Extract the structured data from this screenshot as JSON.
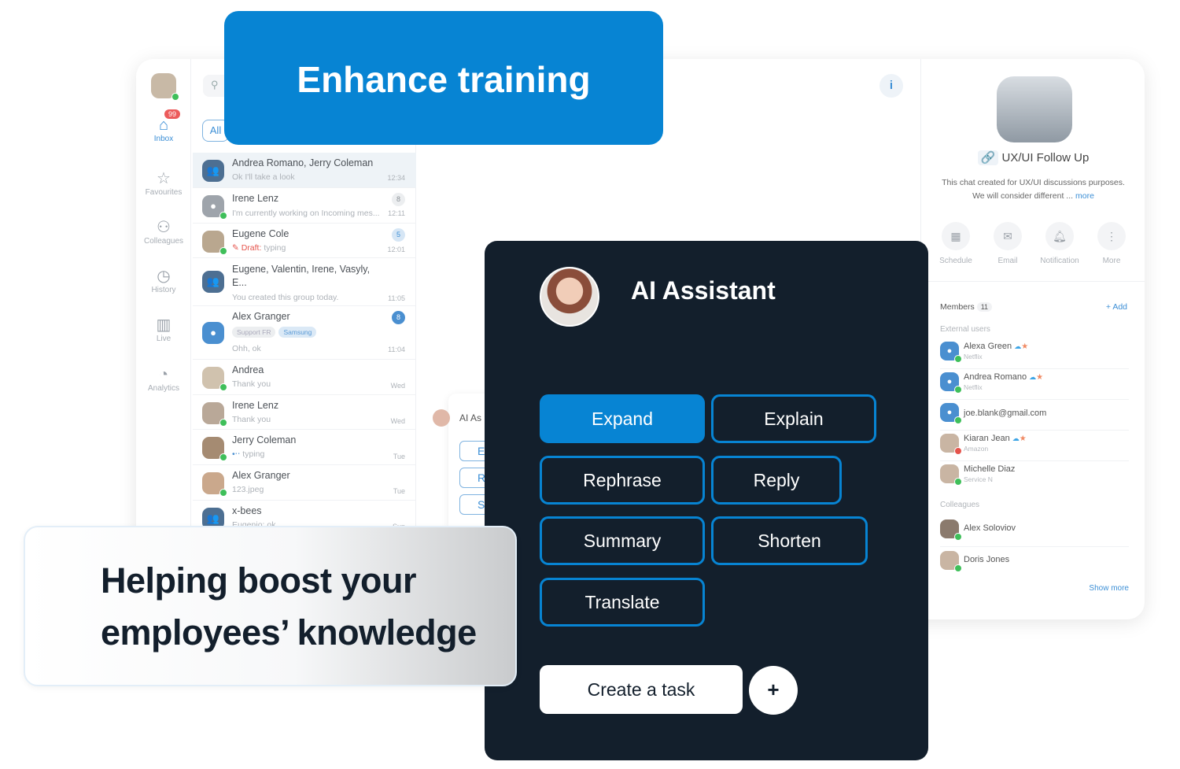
{
  "banner": {
    "title": "Enhance training"
  },
  "sidebar": {
    "inbox_badge": "99",
    "items": [
      {
        "label": "Inbox",
        "icon": "inbox-icon"
      },
      {
        "label": "Favourites",
        "icon": "star-icon"
      },
      {
        "label": "Colleagues",
        "icon": "users-icon"
      },
      {
        "label": "History",
        "icon": "clock-icon"
      },
      {
        "label": "Live",
        "icon": "bar-chart-icon"
      },
      {
        "label": "Analytics",
        "icon": "pie-chart-icon"
      }
    ]
  },
  "list": {
    "filter_all": "All",
    "chats": [
      {
        "name": "Andrea Romano, Jerry Coleman",
        "preview": "Ok I'll take a look",
        "time": "12:34"
      },
      {
        "name": "Irene Lenz",
        "preview": "I'm currently working on Incoming mes...",
        "time": "12:11",
        "count": "8"
      },
      {
        "name": "Eugene Cole",
        "draft": "Draft:",
        "preview": "typing",
        "time": "12:01",
        "count": "5"
      },
      {
        "name": "Eugene, Valentin, Irene, Vasyly, E...",
        "preview": "You created this group today.",
        "time": "11:05"
      },
      {
        "name": "Alex Granger",
        "tags": [
          "Support FR",
          "Samsung"
        ],
        "preview": "Ohh, ok",
        "time": "11:04",
        "count": "8"
      },
      {
        "name": "Andrea",
        "preview": "Thank you",
        "time": "Wed"
      },
      {
        "name": "Irene Lenz",
        "preview": "Thank you",
        "time": "Wed"
      },
      {
        "name": "Jerry Coleman",
        "preview": "typing",
        "time": "Tue"
      },
      {
        "name": "Alex Granger",
        "preview": "123.jpeg",
        "time": "Tue"
      },
      {
        "name": "x-bees",
        "preview": "Eugenio: ok",
        "time": "Sun"
      }
    ]
  },
  "details": {
    "title": "UX/UI Follow Up",
    "description": "This chat created for UX/UI discussions purposes.",
    "description2": "We will consider different ...",
    "more": "more",
    "actions": [
      "Schedule",
      "Email",
      "Notification",
      "More"
    ],
    "members_label": "Members",
    "members_count": "11",
    "add": "+ Add",
    "external_label": "External users",
    "colleagues_label": "Colleagues",
    "show_more": "Show more",
    "external": [
      {
        "name": "Alexa Green",
        "sub": "Netflix"
      },
      {
        "name": "Andrea Romano",
        "sub": "Netflix"
      },
      {
        "name": "joe.blank@gmail.com",
        "sub": ""
      },
      {
        "name": "Kiaran Jean",
        "sub": "Amazon"
      },
      {
        "name": "Michelle Diaz",
        "sub": "Service N"
      }
    ],
    "colleagues": [
      {
        "name": "Alex Soloviov"
      },
      {
        "name": "Doris Jones"
      }
    ]
  },
  "ghost": {
    "title": "AI As",
    "btns": [
      "E",
      "R",
      "S"
    ]
  },
  "assistant": {
    "title": "AI Assistant",
    "buttons": [
      "Expand",
      "Explain",
      "Rephrase",
      "Reply",
      "Summary",
      "Shorten",
      "Translate"
    ],
    "create_task": "Create a task",
    "plus": "+"
  },
  "tagline": {
    "line1": "Helping boost your",
    "line2": "employees’ knowledge"
  },
  "colors": {
    "brand": "#0784d3",
    "dark": "#131f2c"
  }
}
